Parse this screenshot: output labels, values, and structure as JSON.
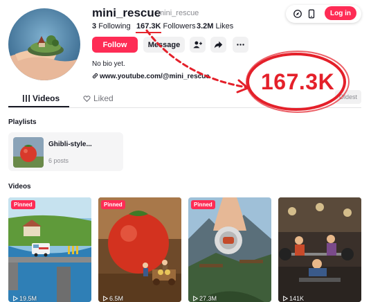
{
  "profile": {
    "username": "mini_rescue",
    "handle": "mini_rescue",
    "following_count": "3",
    "following_label": "Following",
    "followers_count": "167.3K",
    "followers_label": "Followers",
    "likes_count": "3.2M",
    "likes_label": "Likes",
    "bio": "No bio yet.",
    "link": "www.youtube.com/@mini_rescue"
  },
  "actions": {
    "follow_label": "Follow",
    "message_label": "Message",
    "login_label": "Log in"
  },
  "tabs": [
    {
      "label": "Videos"
    },
    {
      "label": "Liked"
    }
  ],
  "sort": {
    "oldest_label": "Oldest"
  },
  "playlists": {
    "heading": "Playlists",
    "items": [
      {
        "title": "Ghibli-style...",
        "count": "6 posts"
      }
    ]
  },
  "videos": {
    "heading": "Videos",
    "pinned_label": "Pinned",
    "items": [
      {
        "views": "19.5M"
      },
      {
        "views": "6.5M"
      },
      {
        "views": "27.3M"
      },
      {
        "views": "141K"
      }
    ]
  },
  "annotation": {
    "text": "167.3K"
  },
  "colors": {
    "accent": "#fe2c55",
    "annotation_red": "#e4202a"
  },
  "icons": [
    "compass-icon",
    "phone-icon",
    "add-user-icon",
    "share-icon",
    "more-icon",
    "grid-icon",
    "heart-lock-icon",
    "play-icon"
  ]
}
